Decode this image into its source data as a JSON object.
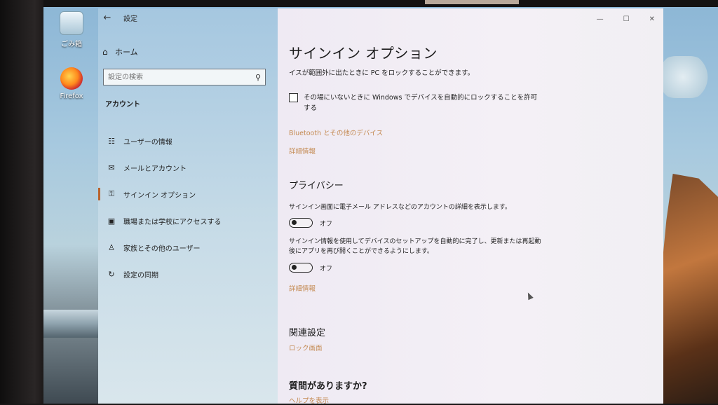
{
  "desktop": {
    "icons": [
      {
        "label": "ごみ箱"
      },
      {
        "label": "Firefox"
      }
    ]
  },
  "window": {
    "title": "設定",
    "back_icon": "back-arrow-icon",
    "controls": {
      "minimize": "—",
      "maximize": "☐",
      "close": "✕"
    }
  },
  "sidebar": {
    "home": "ホーム",
    "search_placeholder": "設定の検索",
    "section": "アカウント",
    "items": [
      {
        "label": "ユーザーの情報",
        "icon": "user-info-icon"
      },
      {
        "label": "メールとアカウント",
        "icon": "mail-icon"
      },
      {
        "label": "サインイン オプション",
        "icon": "key-icon",
        "active": true
      },
      {
        "label": "職場または学校にアクセスする",
        "icon": "briefcase-icon"
      },
      {
        "label": "家族とその他のユーザー",
        "icon": "person-icon"
      },
      {
        "label": "設定の同期",
        "icon": "sync-icon"
      }
    ]
  },
  "content": {
    "title": "サインイン オプション",
    "dynamic_lock_desc": "イスが範囲外に出たときに PC をロックすることができます。",
    "dynamic_lock_checkbox": "その場にいないときに Windows でデバイスを自動的にロックすることを許可する",
    "bluetooth_link": "Bluetooth とその他のデバイス",
    "details_link_1": "詳細情報",
    "privacy_heading": "プライバシー",
    "privacy_setting_1": "サインイン画面に電子メール アドレスなどのアカウントの詳細を表示します。",
    "toggle_1_state": "オフ",
    "privacy_setting_2": "サインイン情報を使用してデバイスのセットアップを自動的に完了し、更新または再起動後にアプリを再び開くことができるようにします。",
    "toggle_2_state": "オフ",
    "details_link_2": "詳細情報",
    "related_heading": "関連設定",
    "lock_screen_link": "ロック画面",
    "question_heading": "質問がありますか?",
    "help_link": "ヘルプを表示"
  },
  "colors": {
    "accent": "#b9642d",
    "link": "#c48a52"
  }
}
